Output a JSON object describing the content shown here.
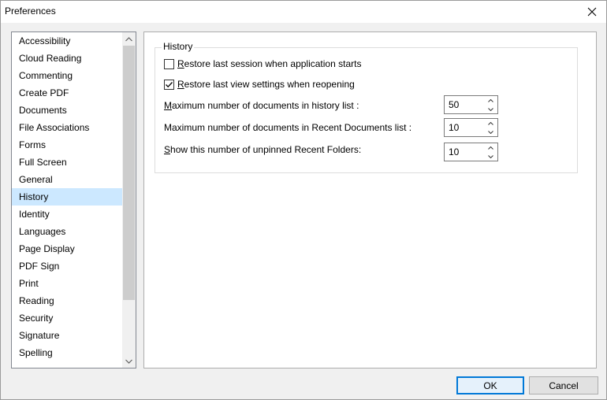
{
  "window": {
    "title": "Preferences"
  },
  "categories": [
    "Accessibility",
    "Cloud Reading",
    "Commenting",
    "Create PDF",
    "Documents",
    "File Associations",
    "Forms",
    "Full Screen",
    "General",
    "History",
    "Identity",
    "Languages",
    "Page Display",
    "PDF Sign",
    "Print",
    "Reading",
    "Security",
    "Signature",
    "Spelling"
  ],
  "selected_category": "History",
  "history": {
    "group_title": "History",
    "restore_session": {
      "label_rest": "estore last session when application starts",
      "label_key": "R",
      "checked": false
    },
    "restore_view": {
      "label_rest": "estore last view settings when reopening",
      "label_key": "R",
      "checked": true
    },
    "max_history": {
      "label_key": "M",
      "label_rest": "aximum number of documents in history list :",
      "value": "50"
    },
    "max_recent": {
      "label_key": "",
      "label_rest": "Maximum number of documents in Recent Documents list :",
      "value": "10"
    },
    "unpinned_folders": {
      "label_key": "S",
      "label_rest": "how this number of unpinned Recent Folders:",
      "value": "10"
    }
  },
  "buttons": {
    "ok": "OK",
    "cancel": "Cancel"
  },
  "colors": {
    "selection": "#cce8ff",
    "accent": "#0078d7"
  }
}
